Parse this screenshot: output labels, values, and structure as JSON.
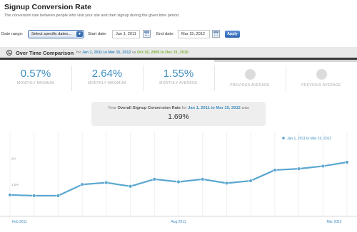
{
  "page": {
    "title": "Signup Conversion Rate",
    "description": "The conversion rate between people who visit your site and then signup during the given time period."
  },
  "toolbar": {
    "date_range_label": "Date range:",
    "date_range_value": "Select specific dates...",
    "start_label": "Start date:",
    "start_value": "Jan 1, 2011",
    "end_label": "End date:",
    "end_value": "Mar 15, 2012",
    "apply_label": "Apply"
  },
  "comparison": {
    "title": "Over Time Comparison",
    "for_label": "for",
    "primary_range": "Jan 1, 2011 to Mar 15, 2012",
    "vs_label": "vs",
    "compare_range": "Oct 16, 2009 to Dec 31, 2010"
  },
  "stats": [
    {
      "value": "0.57%",
      "label": "MONTHLY MINIMUM"
    },
    {
      "value": "2.64%",
      "label": "MONTHLY MAXIMUM"
    },
    {
      "value": "1.55%",
      "label": "MONTHLY AVERAGE"
    },
    {
      "value": "",
      "label": "PREVIOUS AVERAGE"
    },
    {
      "value": "",
      "label": "PREVIOUS AVERAGE"
    }
  ],
  "summary": {
    "prefix": "Your",
    "metric": "Overall Signup Conversion Rate",
    "for_label": "for",
    "range": "Jan 1, 2011 to Mar 15, 2012",
    "suffix": "was",
    "value": "1.69%"
  },
  "colors": {
    "accent": "#3f8fc0",
    "compare": "#7cb23a",
    "line": "#5aa6cf"
  },
  "chart_data": {
    "type": "line",
    "legend": "Jan 1, 2011 to Mar 15, 2012",
    "legend_position": "top-right",
    "x_tick_labels": [
      "Feb 2011",
      "Aug 2011",
      "Mar 2012"
    ],
    "y_tick_labels": [
      "2%",
      "1.0%"
    ],
    "series": [
      {
        "name": "Jan 1, 2011 to Mar 15, 2012",
        "x": [
          "Jan 2011",
          "Feb 2011",
          "Mar 2011",
          "Apr 2011",
          "May 2011",
          "Jun 2011",
          "Jul 2011",
          "Aug 2011",
          "Sep 2011",
          "Oct 2011",
          "Nov 2011",
          "Dec 2011",
          "Jan 2012",
          "Feb 2012",
          "Mar 2012"
        ],
        "values": [
          0.6,
          0.57,
          0.57,
          1.0,
          1.07,
          0.93,
          1.2,
          1.1,
          1.2,
          1.05,
          1.14,
          1.55,
          1.6,
          1.7,
          1.85
        ]
      }
    ],
    "ylim": [
      0,
      2.5
    ],
    "grid": "vertical"
  }
}
